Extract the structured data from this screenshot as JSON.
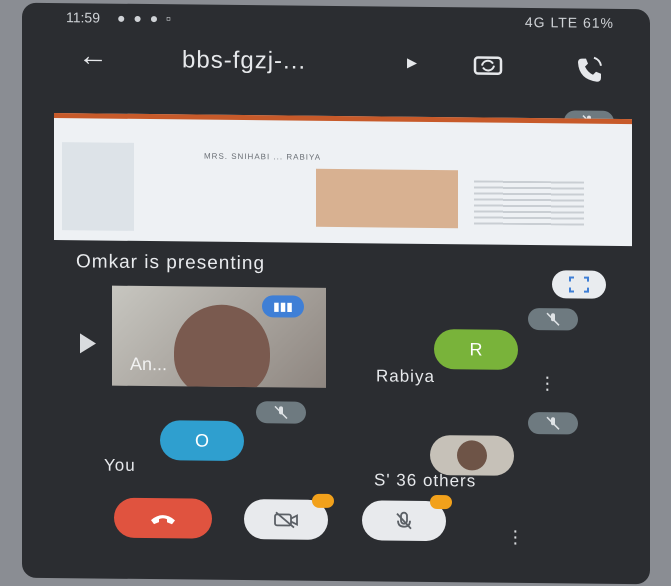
{
  "status": {
    "time": "11:59",
    "right": "4G LTE 61%"
  },
  "header": {
    "title": "bbs-fgzj-..."
  },
  "presentation": {
    "label": "Omkar is presenting",
    "slide_heading": "MRS. SNIHABI ... RABIYA"
  },
  "participants": {
    "tile_name": "An...",
    "rabiya_initial": "R",
    "rabiya_name": "Rabiya",
    "you_initial": "O",
    "you_name": "You",
    "others_label": "S' 36 others"
  },
  "colors": {
    "end_call": "#e0533f",
    "rabiya": "#79b33a",
    "you": "#2f9fcf",
    "speaking": "#3f7fd6",
    "warning": "#f2a11b"
  }
}
